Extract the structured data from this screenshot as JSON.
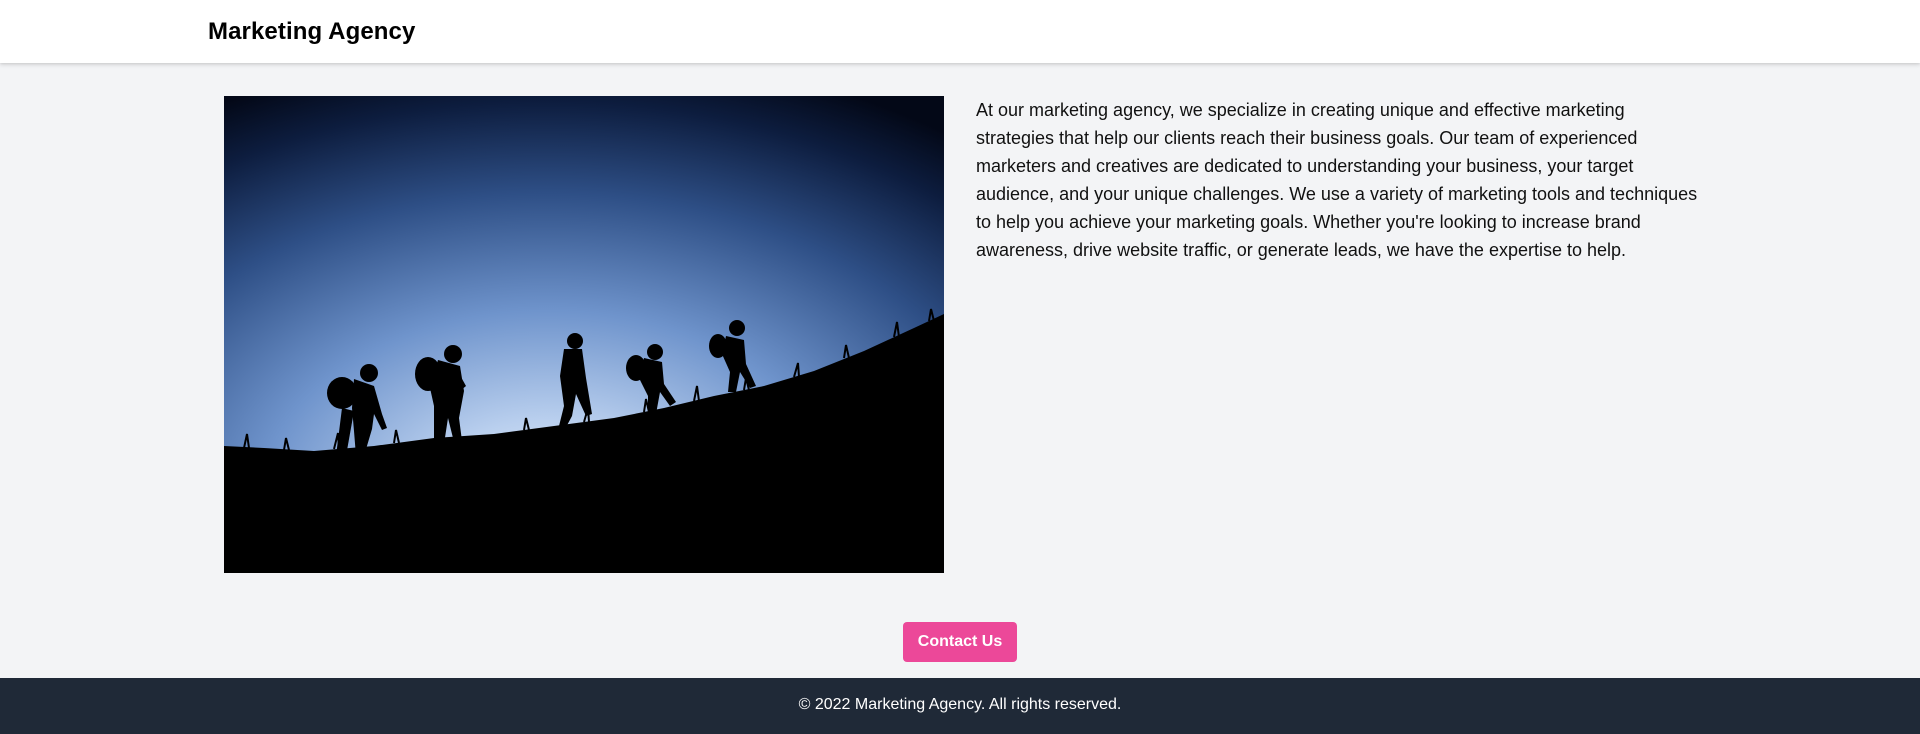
{
  "header": {
    "brand": "Marketing Agency"
  },
  "main": {
    "image": {
      "subject": "hikers-silhouette-photo"
    },
    "description": "At our marketing agency, we specialize in creating unique and effective marketing strategies that help our clients reach their business goals. Our team of experienced marketers and creatives are dedicated to understanding your business, your target audience, and your unique challenges. We use a variety of marketing tools and techniques to help you achieve your marketing goals. Whether you're looking to increase brand awareness, drive website traffic, or generate leads, we have the expertise to help."
  },
  "contact": {
    "button_label": "Contact Us"
  },
  "footer": {
    "text": "© 2022 Marketing Agency. All rights reserved."
  },
  "colors": {
    "accent": "#ec4899",
    "footer_bg": "#1f2937",
    "page_bg": "#f3f4f6",
    "header_bg": "#ffffff"
  }
}
